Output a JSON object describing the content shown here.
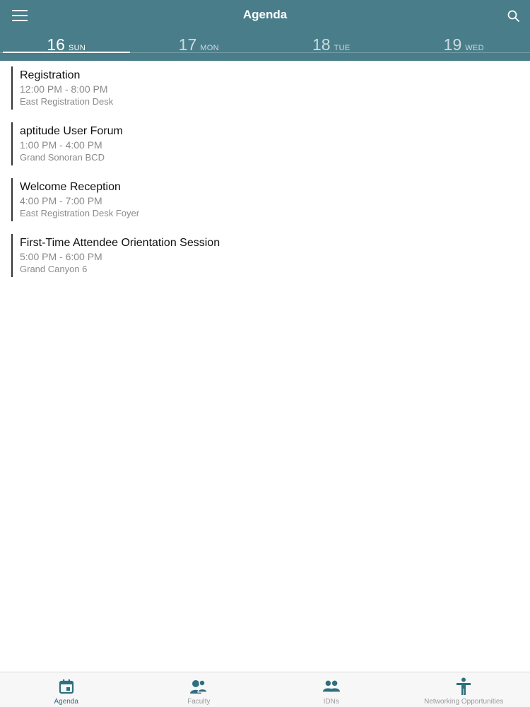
{
  "header": {
    "title": "Agenda",
    "menu_icon": "hamburger-menu-icon",
    "search_icon": "search-icon",
    "color": "#4a7d8a"
  },
  "days": [
    {
      "num": "16",
      "name": "SUN",
      "active": true
    },
    {
      "num": "17",
      "name": "MON",
      "active": false
    },
    {
      "num": "18",
      "name": "TUE",
      "active": false
    },
    {
      "num": "19",
      "name": "WED",
      "active": false
    }
  ],
  "events": [
    {
      "title": "Registration",
      "time": "12:00 PM - 8:00 PM",
      "location": "East Registration Desk"
    },
    {
      "title": "aptitude User Forum",
      "time": "1:00 PM - 4:00 PM",
      "location": "Grand Sonoran BCD"
    },
    {
      "title": "Welcome Reception",
      "time": "4:00 PM - 7:00 PM",
      "location": "East Registration Desk Foyer"
    },
    {
      "title": "First-Time Attendee Orientation Session",
      "time": "5:00 PM - 6:00 PM",
      "location": "Grand Canyon 6"
    }
  ],
  "bottom_nav": [
    {
      "label": "Agenda",
      "icon": "calendar-icon",
      "active": true
    },
    {
      "label": "Faculty",
      "icon": "faculty-icon",
      "active": false
    },
    {
      "label": "IDNs",
      "icon": "group-icon",
      "active": false
    },
    {
      "label": "Networking Opportunities",
      "icon": "accessibility-person-icon",
      "active": false
    }
  ],
  "colors": {
    "accent": "#2e6f80",
    "inactive": "#9a9a9a"
  }
}
